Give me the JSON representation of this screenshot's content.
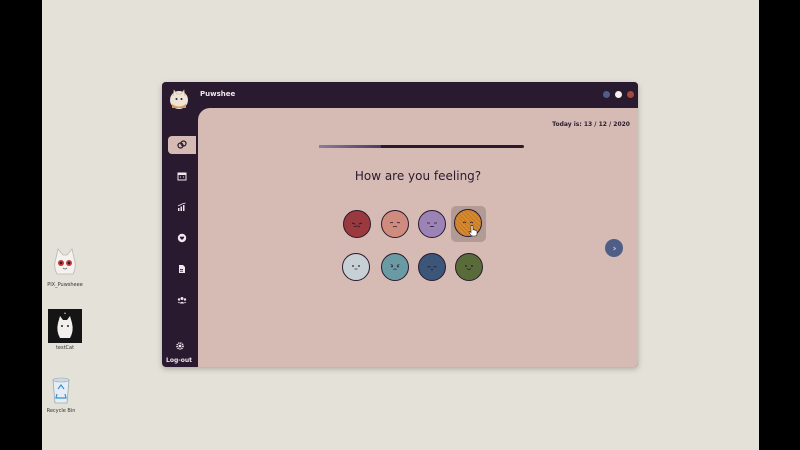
{
  "desktop": {
    "icons": [
      {
        "label": "PIX_Puwsheee"
      },
      {
        "label": "testCat"
      },
      {
        "label": "Recycle Bin"
      }
    ]
  },
  "app": {
    "title": "Puwshee",
    "window_buttons": [
      "minimize",
      "maximize",
      "close"
    ],
    "sidebar": {
      "items": [
        {
          "icon": "mood-icon",
          "active": true
        },
        {
          "icon": "calendar-icon",
          "active": false
        },
        {
          "icon": "stats-icon",
          "active": false
        },
        {
          "icon": "heart-icon",
          "active": false
        },
        {
          "icon": "journal-icon",
          "active": false
        },
        {
          "icon": "community-icon",
          "active": false
        }
      ],
      "logout_label": "Log-out"
    },
    "main": {
      "date": "Today is: 13 / 12 / 2020",
      "progress": 0.3,
      "question": "How are you feeling?",
      "moods": [
        {
          "name": "angry",
          "color": "#9a3a3e"
        },
        {
          "name": "sad",
          "color": "#cf8c7e"
        },
        {
          "name": "calm",
          "color": "#9b83b6"
        },
        {
          "name": "excited",
          "color": "#d98a2f",
          "selected": true
        },
        {
          "name": "meh",
          "color": "#c7d0d4"
        },
        {
          "name": "worried",
          "color": "#6a9aa3"
        },
        {
          "name": "tired",
          "color": "#3b5679"
        },
        {
          "name": "content",
          "color": "#5a6b3a"
        }
      ]
    },
    "colors": {
      "frame": "#2a1a2f",
      "panel": "#d5bbb4",
      "next_button": "#4f5e86"
    }
  }
}
